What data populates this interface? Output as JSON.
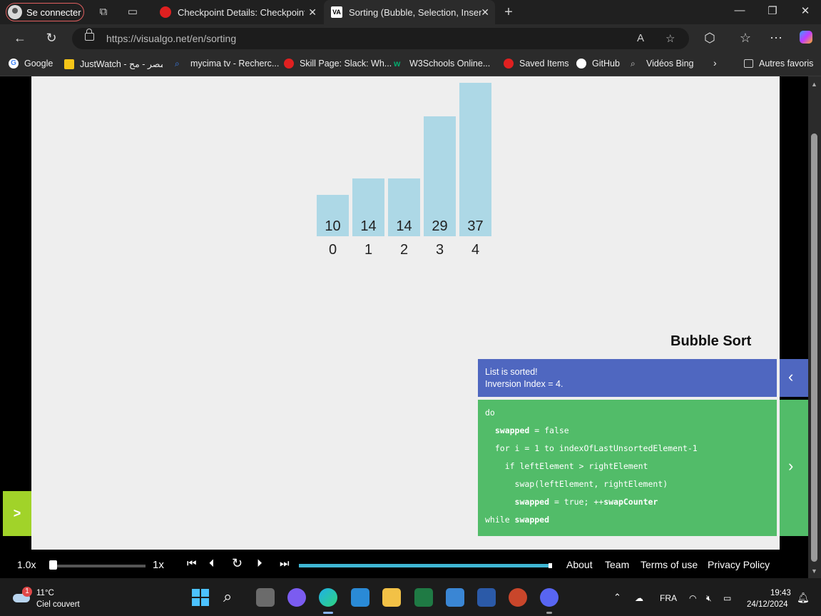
{
  "browser": {
    "profile_label": "Se connecter",
    "tabs": [
      {
        "title": "Checkpoint Details: Checkpoint D",
        "favicon_color": "#e02020",
        "active": false
      },
      {
        "title": "Sorting (Bubble, Selection, Insertio",
        "favicon_text": "VA",
        "active": true
      }
    ],
    "url": "https://visualgo.net/en/sorting",
    "bookmarks": [
      {
        "label": "Google",
        "icon_color": "#4285f4"
      },
      {
        "label": "JustWatch - مصر - مح...",
        "icon_color": "#f5c518"
      },
      {
        "label": "mycima tv - Recherc...",
        "icon_color": "#3b82f6"
      },
      {
        "label": "Skill Page: Slack: Wh...",
        "icon_color": "#e02020"
      },
      {
        "label": "W3Schools Online...",
        "icon_color": "#04aa6d"
      },
      {
        "label": "Saved Items",
        "icon_color": "#e02020"
      },
      {
        "label": "GitHub",
        "icon_color": "#ffffff"
      },
      {
        "label": "Vidéos Bing",
        "icon_color": "#bbbbbb"
      },
      {
        "label": "Autres favoris",
        "icon_color": "#bbbbbb"
      }
    ]
  },
  "visualization": {
    "bars": [
      {
        "value": "10",
        "index": "0",
        "value_num": 10
      },
      {
        "value": "14",
        "index": "1",
        "value_num": 14
      },
      {
        "value": "14",
        "index": "2",
        "value_num": 14
      },
      {
        "value": "29",
        "index": "3",
        "value_num": 29
      },
      {
        "value": "37",
        "index": "4",
        "value_num": 37
      }
    ],
    "bar_color": "#add8e6"
  },
  "panel": {
    "algorithm_title": "Bubble Sort",
    "status_line1": "List is sorted!",
    "status_line2": "Inversion Index = 4.",
    "code": [
      "do",
      "  swapped = false",
      "  for i = 1 to indexOfLastUnsortedElement-1",
      "    if leftElement > rightElement",
      "      swap(leftElement, rightElement)",
      "      swapped = true; ++swapCounter",
      "while swapped"
    ],
    "status_color": "#4f67c0",
    "code_color": "#52bc69",
    "side_button_label": ">",
    "side_button_color": "#a1d329"
  },
  "player": {
    "speed_label": "1.0x",
    "speed_value_label": "1x",
    "speed_fraction": 0.0,
    "progress_fraction": 1.0,
    "links": [
      "About",
      "Team",
      "Terms of use",
      "Privacy Policy"
    ]
  },
  "taskbar": {
    "temperature": "11°C",
    "weather": "Ciel couvert",
    "weather_badge": "1",
    "language": "FRA",
    "time": "19:43",
    "date": "24/12/2024"
  }
}
